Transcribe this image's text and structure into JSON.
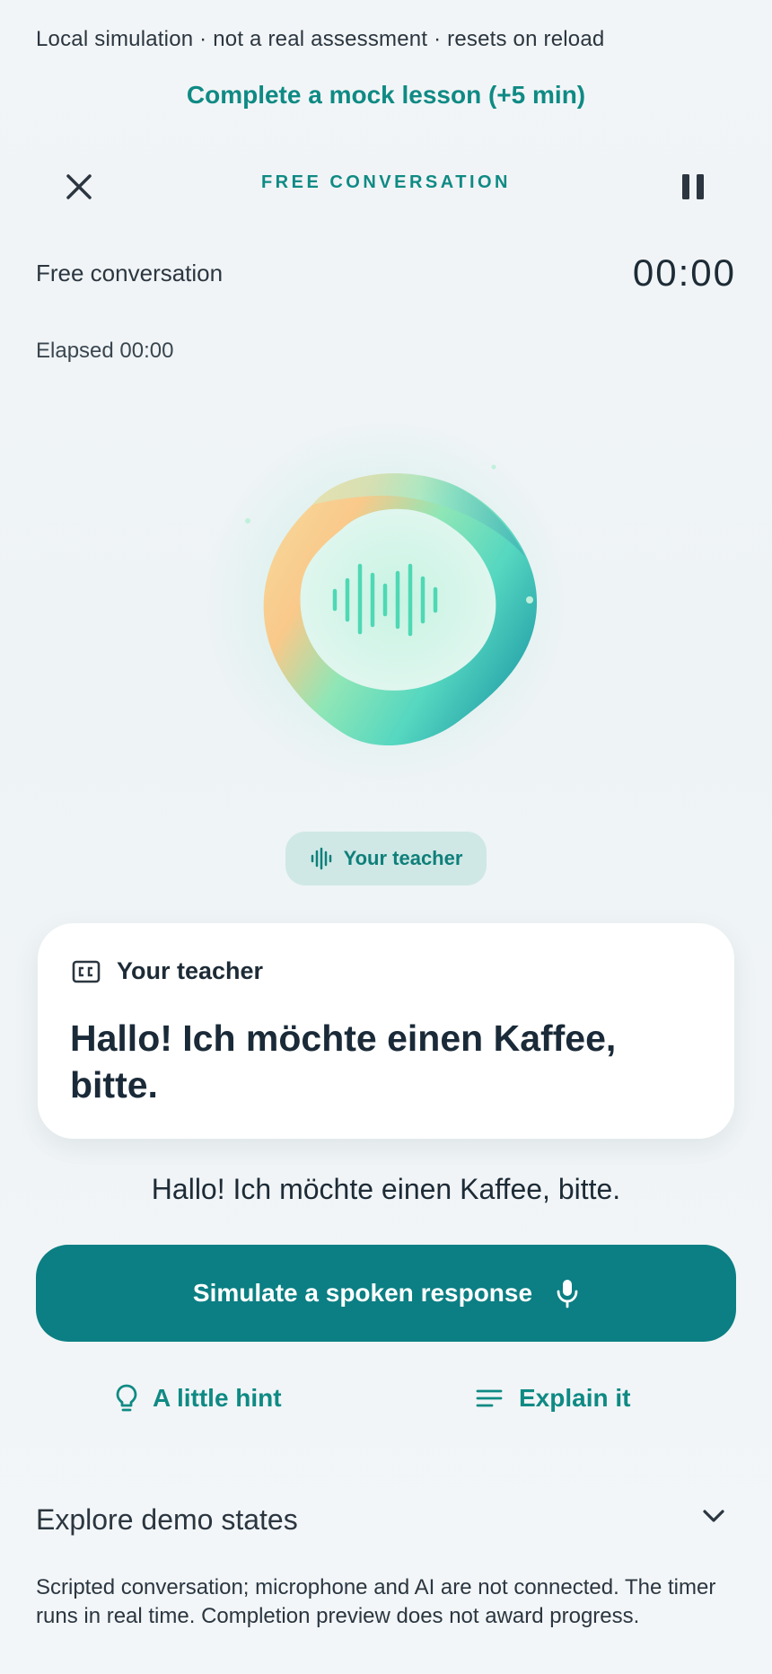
{
  "notice": "Local simulation · not a real assessment · resets on reload",
  "mock_lesson_link": "Complete a mock lesson (+5 min)",
  "topbar": {
    "title": "FREE CONVERSATION",
    "close_icon": "close-icon",
    "pause_icon": "pause-icon"
  },
  "session": {
    "mode": "Free conversation",
    "timer": "00:00",
    "elapsed": "Elapsed 00:00"
  },
  "speaker_pill": {
    "label": "Your teacher",
    "icon": "waveform-icon"
  },
  "caption_card": {
    "icon": "closed-captions-icon",
    "speaker": "Your teacher",
    "text": "Hallo! Ich möchte einen Kaffee, bitte."
  },
  "translation": "Hallo! Ich möchte einen Kaffee, bitte.",
  "primary_button": {
    "label": "Simulate a spoken response",
    "icon": "microphone-icon"
  },
  "hint_button": {
    "label": "A little hint",
    "icon": "lightbulb-icon"
  },
  "explain_button": {
    "label": "Explain it",
    "icon": "lines-icon"
  },
  "explore": {
    "label": "Explore demo states",
    "icon": "chevron-down-icon"
  },
  "footnote": "Scripted conversation; microphone and AI are not connected. The timer runs in real time. Completion preview does not award progress.",
  "colors": {
    "accent": "#0f8a84",
    "primary_button": "#0b7f83",
    "pill_bg": "#cfe8e6",
    "text": "#1d2b36"
  }
}
